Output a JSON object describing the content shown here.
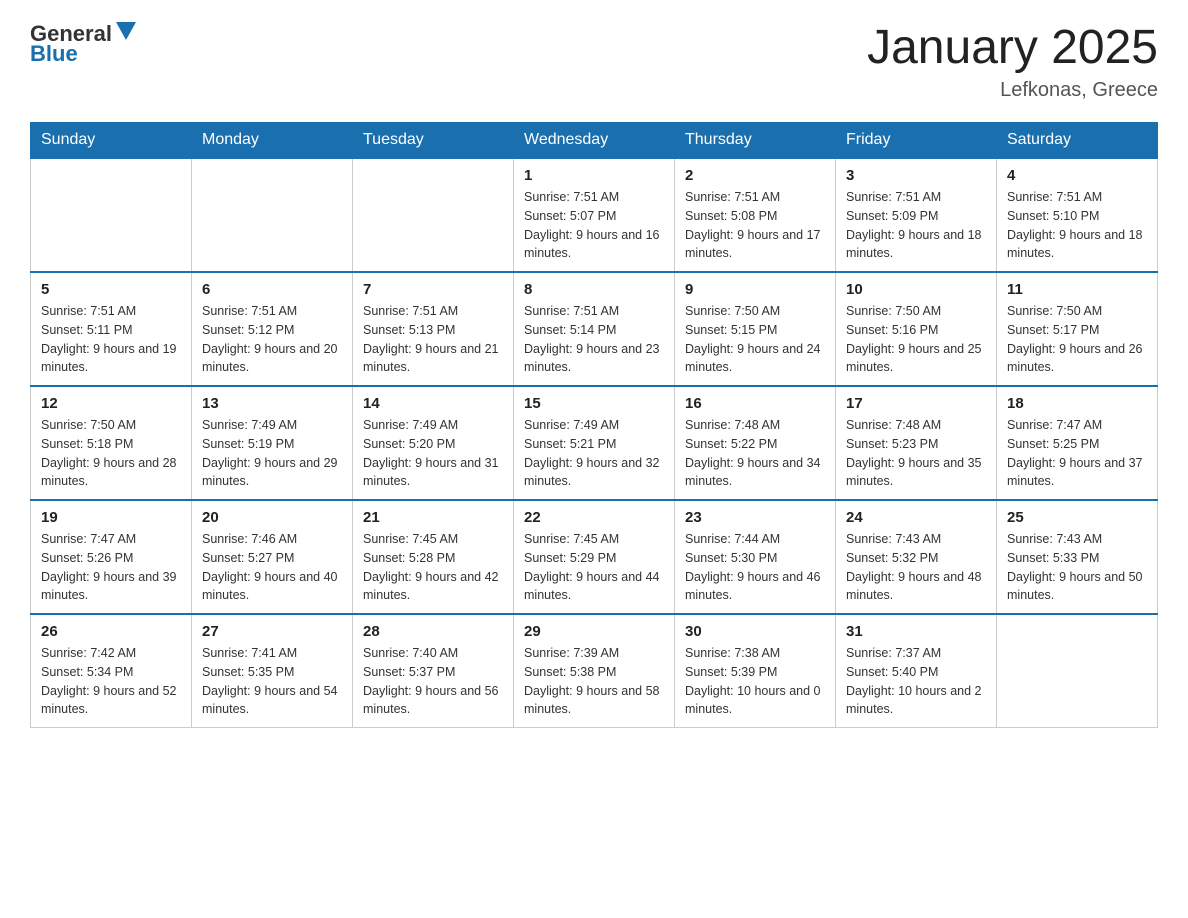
{
  "logo": {
    "general": "General",
    "blue": "Blue"
  },
  "title": "January 2025",
  "subtitle": "Lefkonas, Greece",
  "days_of_week": [
    "Sunday",
    "Monday",
    "Tuesday",
    "Wednesday",
    "Thursday",
    "Friday",
    "Saturday"
  ],
  "weeks": [
    [
      {
        "day": "",
        "sunrise": "",
        "sunset": "",
        "daylight": ""
      },
      {
        "day": "",
        "sunrise": "",
        "sunset": "",
        "daylight": ""
      },
      {
        "day": "",
        "sunrise": "",
        "sunset": "",
        "daylight": ""
      },
      {
        "day": "1",
        "sunrise": "Sunrise: 7:51 AM",
        "sunset": "Sunset: 5:07 PM",
        "daylight": "Daylight: 9 hours and 16 minutes."
      },
      {
        "day": "2",
        "sunrise": "Sunrise: 7:51 AM",
        "sunset": "Sunset: 5:08 PM",
        "daylight": "Daylight: 9 hours and 17 minutes."
      },
      {
        "day": "3",
        "sunrise": "Sunrise: 7:51 AM",
        "sunset": "Sunset: 5:09 PM",
        "daylight": "Daylight: 9 hours and 18 minutes."
      },
      {
        "day": "4",
        "sunrise": "Sunrise: 7:51 AM",
        "sunset": "Sunset: 5:10 PM",
        "daylight": "Daylight: 9 hours and 18 minutes."
      }
    ],
    [
      {
        "day": "5",
        "sunrise": "Sunrise: 7:51 AM",
        "sunset": "Sunset: 5:11 PM",
        "daylight": "Daylight: 9 hours and 19 minutes."
      },
      {
        "day": "6",
        "sunrise": "Sunrise: 7:51 AM",
        "sunset": "Sunset: 5:12 PM",
        "daylight": "Daylight: 9 hours and 20 minutes."
      },
      {
        "day": "7",
        "sunrise": "Sunrise: 7:51 AM",
        "sunset": "Sunset: 5:13 PM",
        "daylight": "Daylight: 9 hours and 21 minutes."
      },
      {
        "day": "8",
        "sunrise": "Sunrise: 7:51 AM",
        "sunset": "Sunset: 5:14 PM",
        "daylight": "Daylight: 9 hours and 23 minutes."
      },
      {
        "day": "9",
        "sunrise": "Sunrise: 7:50 AM",
        "sunset": "Sunset: 5:15 PM",
        "daylight": "Daylight: 9 hours and 24 minutes."
      },
      {
        "day": "10",
        "sunrise": "Sunrise: 7:50 AM",
        "sunset": "Sunset: 5:16 PM",
        "daylight": "Daylight: 9 hours and 25 minutes."
      },
      {
        "day": "11",
        "sunrise": "Sunrise: 7:50 AM",
        "sunset": "Sunset: 5:17 PM",
        "daylight": "Daylight: 9 hours and 26 minutes."
      }
    ],
    [
      {
        "day": "12",
        "sunrise": "Sunrise: 7:50 AM",
        "sunset": "Sunset: 5:18 PM",
        "daylight": "Daylight: 9 hours and 28 minutes."
      },
      {
        "day": "13",
        "sunrise": "Sunrise: 7:49 AM",
        "sunset": "Sunset: 5:19 PM",
        "daylight": "Daylight: 9 hours and 29 minutes."
      },
      {
        "day": "14",
        "sunrise": "Sunrise: 7:49 AM",
        "sunset": "Sunset: 5:20 PM",
        "daylight": "Daylight: 9 hours and 31 minutes."
      },
      {
        "day": "15",
        "sunrise": "Sunrise: 7:49 AM",
        "sunset": "Sunset: 5:21 PM",
        "daylight": "Daylight: 9 hours and 32 minutes."
      },
      {
        "day": "16",
        "sunrise": "Sunrise: 7:48 AM",
        "sunset": "Sunset: 5:22 PM",
        "daylight": "Daylight: 9 hours and 34 minutes."
      },
      {
        "day": "17",
        "sunrise": "Sunrise: 7:48 AM",
        "sunset": "Sunset: 5:23 PM",
        "daylight": "Daylight: 9 hours and 35 minutes."
      },
      {
        "day": "18",
        "sunrise": "Sunrise: 7:47 AM",
        "sunset": "Sunset: 5:25 PM",
        "daylight": "Daylight: 9 hours and 37 minutes."
      }
    ],
    [
      {
        "day": "19",
        "sunrise": "Sunrise: 7:47 AM",
        "sunset": "Sunset: 5:26 PM",
        "daylight": "Daylight: 9 hours and 39 minutes."
      },
      {
        "day": "20",
        "sunrise": "Sunrise: 7:46 AM",
        "sunset": "Sunset: 5:27 PM",
        "daylight": "Daylight: 9 hours and 40 minutes."
      },
      {
        "day": "21",
        "sunrise": "Sunrise: 7:45 AM",
        "sunset": "Sunset: 5:28 PM",
        "daylight": "Daylight: 9 hours and 42 minutes."
      },
      {
        "day": "22",
        "sunrise": "Sunrise: 7:45 AM",
        "sunset": "Sunset: 5:29 PM",
        "daylight": "Daylight: 9 hours and 44 minutes."
      },
      {
        "day": "23",
        "sunrise": "Sunrise: 7:44 AM",
        "sunset": "Sunset: 5:30 PM",
        "daylight": "Daylight: 9 hours and 46 minutes."
      },
      {
        "day": "24",
        "sunrise": "Sunrise: 7:43 AM",
        "sunset": "Sunset: 5:32 PM",
        "daylight": "Daylight: 9 hours and 48 minutes."
      },
      {
        "day": "25",
        "sunrise": "Sunrise: 7:43 AM",
        "sunset": "Sunset: 5:33 PM",
        "daylight": "Daylight: 9 hours and 50 minutes."
      }
    ],
    [
      {
        "day": "26",
        "sunrise": "Sunrise: 7:42 AM",
        "sunset": "Sunset: 5:34 PM",
        "daylight": "Daylight: 9 hours and 52 minutes."
      },
      {
        "day": "27",
        "sunrise": "Sunrise: 7:41 AM",
        "sunset": "Sunset: 5:35 PM",
        "daylight": "Daylight: 9 hours and 54 minutes."
      },
      {
        "day": "28",
        "sunrise": "Sunrise: 7:40 AM",
        "sunset": "Sunset: 5:37 PM",
        "daylight": "Daylight: 9 hours and 56 minutes."
      },
      {
        "day": "29",
        "sunrise": "Sunrise: 7:39 AM",
        "sunset": "Sunset: 5:38 PM",
        "daylight": "Daylight: 9 hours and 58 minutes."
      },
      {
        "day": "30",
        "sunrise": "Sunrise: 7:38 AM",
        "sunset": "Sunset: 5:39 PM",
        "daylight": "Daylight: 10 hours and 0 minutes."
      },
      {
        "day": "31",
        "sunrise": "Sunrise: 7:37 AM",
        "sunset": "Sunset: 5:40 PM",
        "daylight": "Daylight: 10 hours and 2 minutes."
      },
      {
        "day": "",
        "sunrise": "",
        "sunset": "",
        "daylight": ""
      }
    ]
  ]
}
